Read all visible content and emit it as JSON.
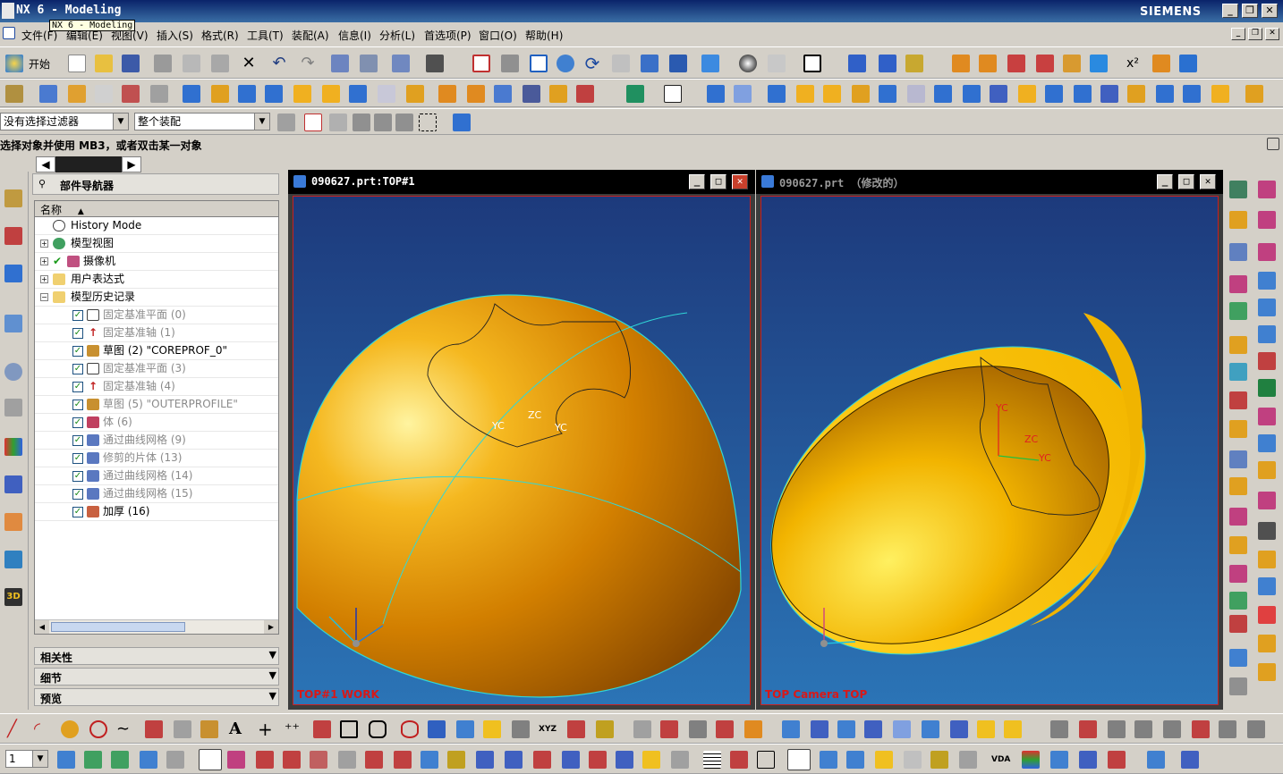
{
  "titlebar": {
    "title": "NX 6 - Modeling",
    "tooltip": "NX 6 - Modeling",
    "brand": "SIEMENS"
  },
  "menus": [
    "文件(F)",
    "编辑(E)",
    "视图(V)",
    "插入(S)",
    "格式(R)",
    "工具(T)",
    "装配(A)",
    "信息(I)",
    "分析(L)",
    "首选项(P)",
    "窗口(O)",
    "帮助(H)"
  ],
  "toolbar": {
    "start_label": "开始"
  },
  "selection_filter": {
    "value": "没有选择过滤器"
  },
  "assembly_scope": {
    "value": "整个装配"
  },
  "cue_line": "选择对象并使用 MB3，或者双击某一对象",
  "navigator": {
    "title": "部件导航器",
    "column_header": "名称",
    "items": [
      {
        "label": "History Mode"
      },
      {
        "label": "模型视图"
      },
      {
        "label": "摄像机"
      },
      {
        "label": "用户表达式"
      },
      {
        "label": "模型历史记录"
      },
      {
        "label": "固定基准平面 (0)"
      },
      {
        "label": "固定基准轴 (1)"
      },
      {
        "label": "草图 (2) \"COREPROF_0\""
      },
      {
        "label": "固定基准平面 (3)"
      },
      {
        "label": "固定基准轴 (4)"
      },
      {
        "label": "草图 (5) \"OUTERPROFILE\""
      },
      {
        "label": "体 (6)"
      },
      {
        "label": "通过曲线网格 (9)"
      },
      {
        "label": "修剪的片体 (13)"
      },
      {
        "label": "通过曲线网格 (14)"
      },
      {
        "label": "通过曲线网格 (15)"
      },
      {
        "label": "加厚 (16)"
      }
    ],
    "panels": [
      "相关性",
      "细节",
      "预览"
    ]
  },
  "viewports": [
    {
      "title": "090627.prt:TOP#1",
      "label": "TOP#1 WORK",
      "axes": {
        "yc": "YC",
        "zc": "ZC",
        "xc": "YC"
      }
    },
    {
      "title": "090627.prt （修改的）",
      "label": "TOP Camera TOP",
      "axes": {
        "yc": "YC",
        "zc": "ZC",
        "xc": "YC"
      }
    }
  ],
  "bottom_toolbar": {
    "layer_value": "1"
  },
  "colors": {
    "part_gold": "#f2a900",
    "viewport_top": "#1d3a7c",
    "viewport_bottom": "#2b74b6",
    "edge_cyan": "#30d8d8"
  }
}
